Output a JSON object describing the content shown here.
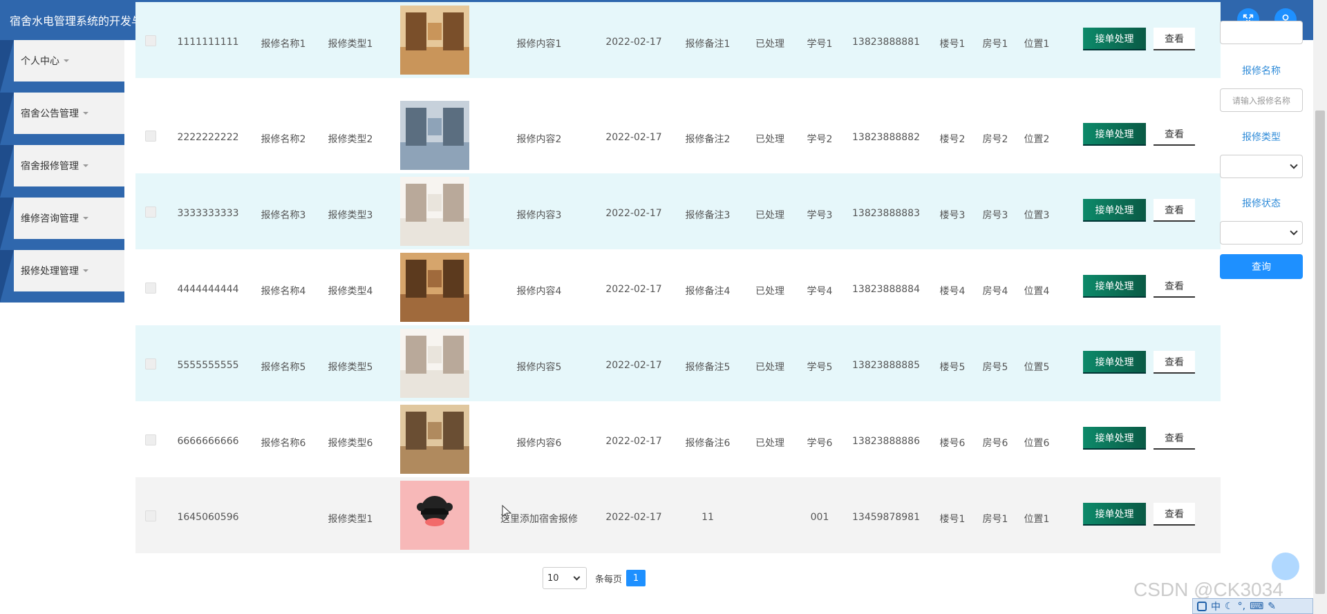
{
  "app": {
    "title": "宿舍水电管理系统的开发与实现"
  },
  "sidebar": {
    "items": [
      {
        "label": "个人中心"
      },
      {
        "label": "宿舍公告管理"
      },
      {
        "label": "宿舍报修管理"
      },
      {
        "label": "维修咨询管理"
      },
      {
        "label": "报修处理管理"
      }
    ]
  },
  "table": {
    "handle_label": "接单处理",
    "view_label": "查看",
    "rows": [
      {
        "id": "1111111111",
        "name": "报修名称1",
        "type": "报修类型1",
        "content": "报修内容1",
        "date": "2022-02-17",
        "note": "报修备注1",
        "status": "已处理",
        "student": "学号1",
        "phone": "13823888881",
        "building": "楼号1",
        "room": "房号1",
        "location": "位置1",
        "image": "room-photo"
      },
      {
        "id": "2222222222",
        "name": "报修名称2",
        "type": "报修类型2",
        "content": "报修内容2",
        "date": "2022-02-17",
        "note": "报修备注2",
        "status": "已处理",
        "student": "学号2",
        "phone": "13823888882",
        "building": "楼号2",
        "room": "房号2",
        "location": "位置2",
        "image": "room-photo"
      },
      {
        "id": "3333333333",
        "name": "报修名称3",
        "type": "报修类型3",
        "content": "报修内容3",
        "date": "2022-02-17",
        "note": "报修备注3",
        "status": "已处理",
        "student": "学号3",
        "phone": "13823888883",
        "building": "楼号3",
        "room": "房号3",
        "location": "位置3",
        "image": "room-photo"
      },
      {
        "id": "4444444444",
        "name": "报修名称4",
        "type": "报修类型4",
        "content": "报修内容4",
        "date": "2022-02-17",
        "note": "报修备注4",
        "status": "已处理",
        "student": "学号4",
        "phone": "13823888884",
        "building": "楼号4",
        "room": "房号4",
        "location": "位置4",
        "image": "room-photo"
      },
      {
        "id": "5555555555",
        "name": "报修名称5",
        "type": "报修类型5",
        "content": "报修内容5",
        "date": "2022-02-17",
        "note": "报修备注5",
        "status": "已处理",
        "student": "学号5",
        "phone": "13823888885",
        "building": "楼号5",
        "room": "房号5",
        "location": "位置5",
        "image": "room-photo"
      },
      {
        "id": "6666666666",
        "name": "报修名称6",
        "type": "报修类型6",
        "content": "报修内容6",
        "date": "2022-02-17",
        "note": "报修备注6",
        "status": "已处理",
        "student": "学号6",
        "phone": "13823888886",
        "building": "楼号6",
        "room": "房号6",
        "location": "位置6",
        "image": "room-photo"
      },
      {
        "id": "1645060596",
        "name": "",
        "type": "报修类型1",
        "content": "这里添加宿舍报修",
        "date": "2022-02-17",
        "note": "11",
        "status": "",
        "student": "001",
        "phone": "13459878981",
        "building": "楼号1",
        "room": "房号1",
        "location": "位置1",
        "image": "cartoon-avatar"
      }
    ]
  },
  "filter": {
    "name_label": "报修名称",
    "name_placeholder": "请输入报修名称",
    "type_label": "报修类型",
    "status_label": "报修状态",
    "search_label": "查询"
  },
  "pagination": {
    "page_size": "10",
    "per_page_label": "条每页",
    "current_page": "1"
  },
  "watermark": "CSDN @CK3034",
  "taskbar": {
    "ime": "中"
  },
  "colors": {
    "header": "#2f67ad",
    "accent": "#1e90ff",
    "handle_button": "#0d8a6a",
    "row_highlight": "#e6f7fa"
  }
}
